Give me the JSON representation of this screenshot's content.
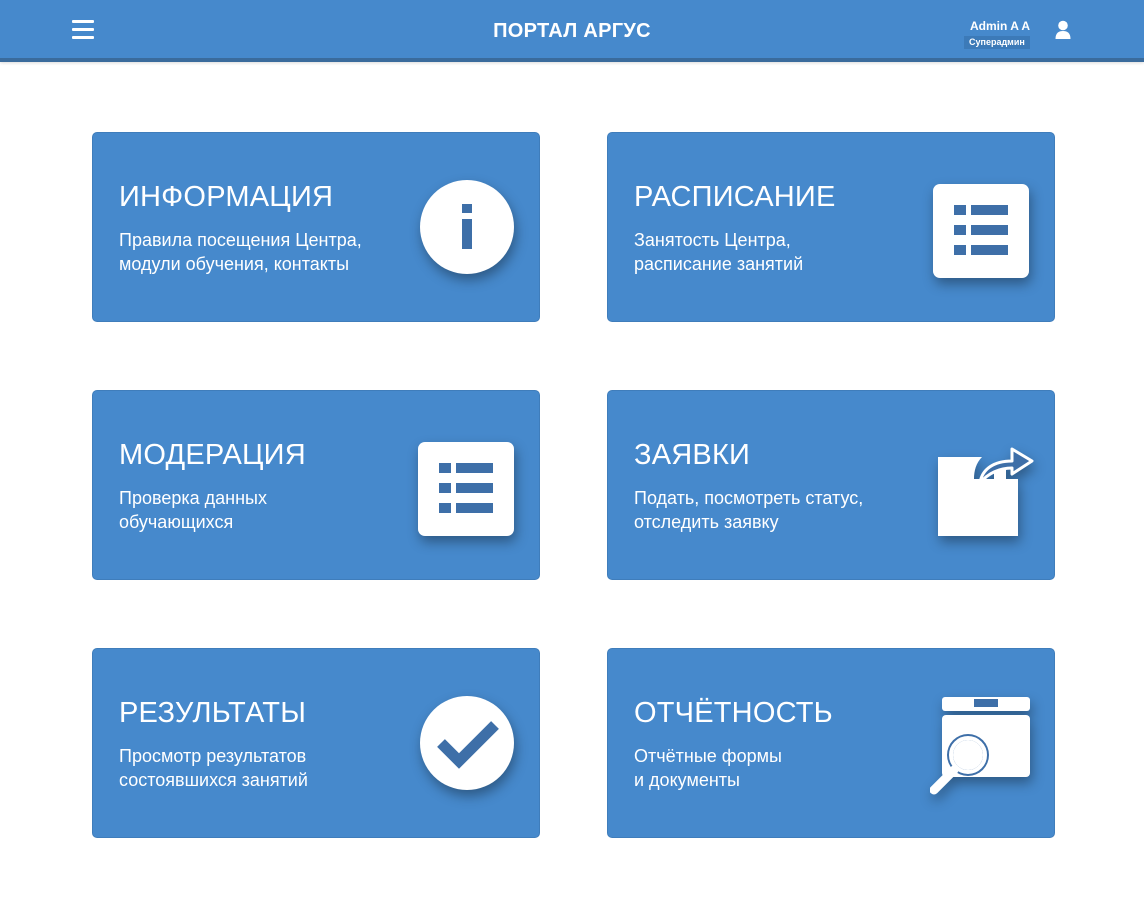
{
  "header": {
    "title": "ПОРТАЛ АРГУС",
    "menu_icon": "hamburger-menu-icon",
    "user_name": "Admin A A",
    "user_role": "Суперадмин",
    "user_icon": "user-icon"
  },
  "colors": {
    "header_bg": "#4689cc",
    "card_bg": "#4689cc",
    "icon_fg": "#ffffff",
    "icon_accent": "#3e6fa8"
  },
  "cards": [
    {
      "title": "ИНФОРМАЦИЯ",
      "desc_line1": "Правила посещения Центра,",
      "desc_line2": "модули обучения, контакты",
      "icon": "info-icon"
    },
    {
      "title": "РАСПИСАНИЕ",
      "desc_line1": "Занятость Центра,",
      "desc_line2": "расписание занятий",
      "icon": "list-icon"
    },
    {
      "title": "МОДЕРАЦИЯ",
      "desc_line1": "Проверка данных",
      "desc_line2": "обучающихся",
      "icon": "list-icon"
    },
    {
      "title": "ЗАЯВКИ",
      "desc_line1": "Подать, посмотреть статус,",
      "desc_line2": "отследить заявку",
      "icon": "share-arrow-icon"
    },
    {
      "title": "РЕЗУЛЬТАТЫ",
      "desc_line1": "Просмотр результатов",
      "desc_line2": "состоявшихся занятий",
      "icon": "checkmark-icon"
    },
    {
      "title": "ОТЧЁТНОСТЬ",
      "desc_line1": "Отчётные формы",
      "desc_line2": "и документы",
      "icon": "archive-search-icon"
    }
  ]
}
